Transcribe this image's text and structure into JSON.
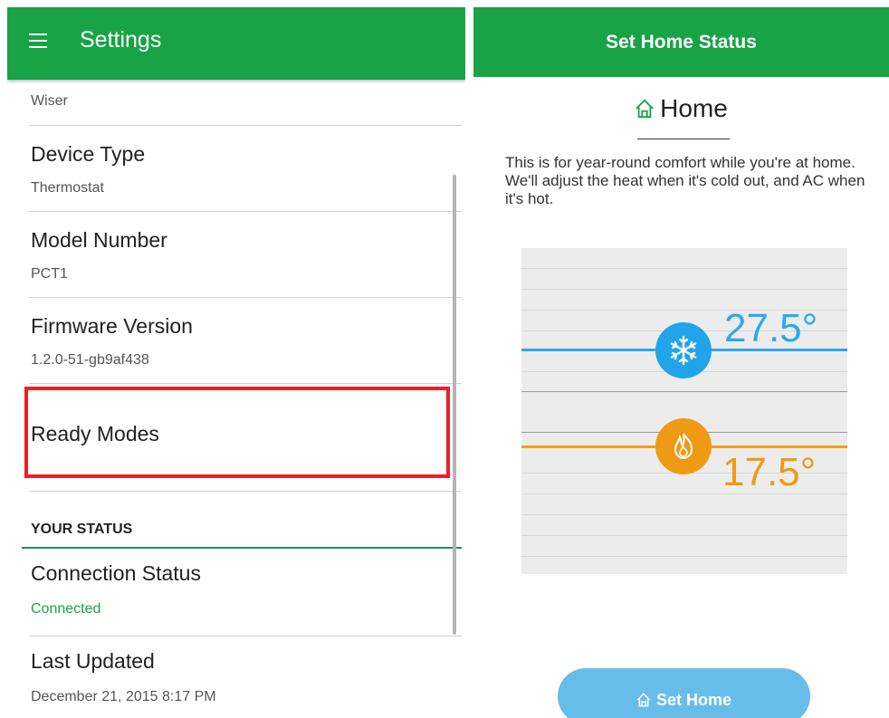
{
  "settings_panel": {
    "title": "Settings",
    "top_value": "Wiser",
    "device_type": {
      "label": "Device Type",
      "value": "Thermostat"
    },
    "model_number": {
      "label": "Model Number",
      "value": "PCT1"
    },
    "firmware_version": {
      "label": "Firmware Version",
      "value": "1.2.0-51-gb9af438"
    },
    "ready_modes": {
      "label": "Ready Modes"
    },
    "status_section": "YOUR STATUS",
    "connection_status": {
      "label": "Connection Status",
      "value": "Connected"
    },
    "last_updated": {
      "label": "Last Updated",
      "value": "December 21, 2015 8:17 PM"
    }
  },
  "home_status_panel": {
    "title": "Set Home Status",
    "mode_title": "Home",
    "description": "This is for year-round comfort while you're at home. We'll adjust the heat when it's cold out, and AC when it's hot.",
    "cool_setpoint": "27.5°",
    "heat_setpoint": "17.5°",
    "button_label": "Set Home"
  },
  "colors": {
    "brand_green": "#19a347",
    "cool_blue": "#2ea8ec",
    "heat_orange": "#ef9a14",
    "highlight_red": "#e8202a",
    "button_blue": "#67bde9"
  },
  "icons": [
    "menu-icon",
    "home-icon",
    "snowflake-icon",
    "flame-icon"
  ]
}
